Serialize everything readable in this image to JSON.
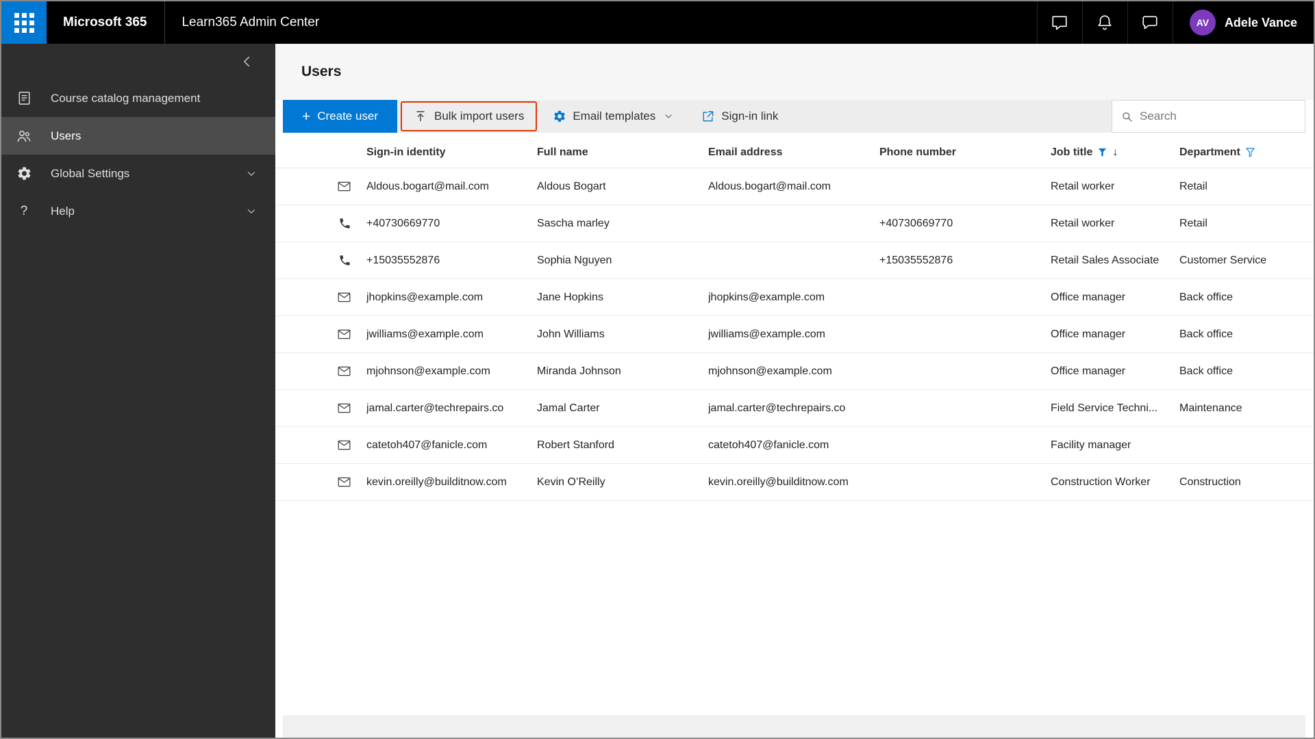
{
  "topbar": {
    "product_name": "Microsoft 365",
    "app_name": "Learn365 Admin Center",
    "user": {
      "initials": "AV",
      "name": "Adele Vance"
    }
  },
  "sidebar": {
    "items": [
      {
        "label": "Course catalog management",
        "selected": false,
        "expandable": false
      },
      {
        "label": "Users",
        "selected": true,
        "expandable": false
      },
      {
        "label": "Global Settings",
        "selected": false,
        "expandable": true
      },
      {
        "label": "Help",
        "selected": false,
        "expandable": true
      }
    ]
  },
  "page": {
    "title": "Users",
    "toolbar": {
      "create_user_label": "Create user",
      "bulk_import_label": "Bulk import users",
      "email_templates_label": "Email templates",
      "signin_link_label": "Sign-in link",
      "search_placeholder": "Search"
    },
    "table": {
      "columns": [
        "Sign-in identity",
        "Full name",
        "Email address",
        "Phone number",
        "Job title",
        "Department"
      ],
      "rows": [
        {
          "icon": "mail",
          "signin": "Aldous.bogart@mail.com",
          "full_name": "Aldous Bogart",
          "email": "Aldous.bogart@mail.com",
          "phone": "",
          "job_title": "Retail worker",
          "department": "Retail"
        },
        {
          "icon": "phone",
          "signin": "+40730669770",
          "full_name": "Sascha marley",
          "email": "",
          "phone": "+40730669770",
          "job_title": "Retail worker",
          "department": "Retail"
        },
        {
          "icon": "phone",
          "signin": "+15035552876",
          "full_name": "Sophia Nguyen",
          "email": "",
          "phone": "+15035552876",
          "job_title": "Retail Sales Associate",
          "department": "Customer Service"
        },
        {
          "icon": "mail",
          "signin": "jhopkins@example.com",
          "full_name": "Jane Hopkins",
          "email": "jhopkins@example.com",
          "phone": "",
          "job_title": "Office manager",
          "department": "Back office"
        },
        {
          "icon": "mail",
          "signin": "jwilliams@example.com",
          "full_name": "John Williams",
          "email": "jwilliams@example.com",
          "phone": "",
          "job_title": "Office manager",
          "department": "Back office"
        },
        {
          "icon": "mail",
          "signin": "mjohnson@example.com",
          "full_name": "Miranda Johnson",
          "email": "mjohnson@example.com",
          "phone": "",
          "job_title": "Office manager",
          "department": "Back office"
        },
        {
          "icon": "mail",
          "signin": "jamal.carter@techrepairs.co",
          "full_name": "Jamal Carter",
          "email": "jamal.carter@techrepairs.co",
          "phone": "",
          "job_title": "Field Service Techni...",
          "department": "Maintenance"
        },
        {
          "icon": "mail",
          "signin": "catetoh407@fanicle.com",
          "full_name": "Robert Stanford",
          "email": "catetoh407@fanicle.com",
          "phone": "",
          "job_title": "Facility manager",
          "department": ""
        },
        {
          "icon": "mail",
          "signin": "kevin.oreilly@builditnow.com",
          "full_name": "Kevin O’Reilly",
          "email": "kevin.oreilly@builditnow.com",
          "phone": "",
          "job_title": "Construction Worker",
          "department": "Construction"
        }
      ]
    }
  },
  "colors": {
    "accent": "#0078d4",
    "highlight_border": "#d83b01",
    "avatar": "#7c3bbd"
  }
}
